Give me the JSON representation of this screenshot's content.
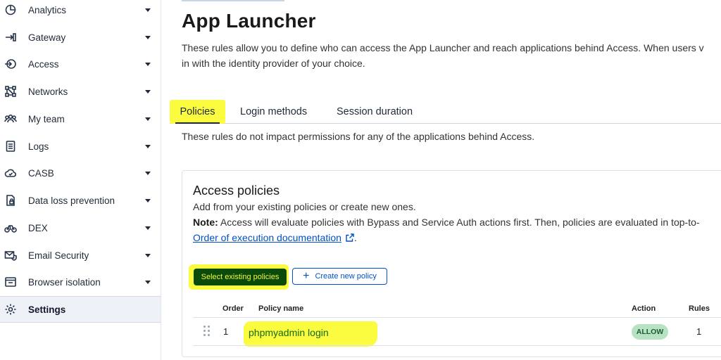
{
  "sidebar": {
    "items": [
      {
        "label": "Analytics",
        "icon": "analytics-icon"
      },
      {
        "label": "Gateway",
        "icon": "gateway-icon"
      },
      {
        "label": "Access",
        "icon": "access-icon"
      },
      {
        "label": "Networks",
        "icon": "networks-icon"
      },
      {
        "label": "My team",
        "icon": "team-icon"
      },
      {
        "label": "Logs",
        "icon": "logs-icon"
      },
      {
        "label": "CASB",
        "icon": "casb-icon"
      },
      {
        "label": "Data loss prevention",
        "icon": "dlp-icon"
      },
      {
        "label": "DEX",
        "icon": "dex-icon"
      },
      {
        "label": "Email Security",
        "icon": "email-security-icon"
      },
      {
        "label": "Browser isolation",
        "icon": "browser-isolation-icon"
      },
      {
        "label": "Settings",
        "icon": "gear-icon",
        "active": true
      }
    ]
  },
  "page": {
    "title": "App Launcher",
    "description_line1": "These rules allow you to define who can access the App Launcher and reach applications behind Access. When users v",
    "description_line2": "in with the identity provider of your choice."
  },
  "tabs": [
    {
      "label": "Policies",
      "active": true
    },
    {
      "label": "Login methods"
    },
    {
      "label": "Session duration"
    }
  ],
  "tab_description": "These rules do not impact permissions for any of the applications behind Access.",
  "policies_card": {
    "title": "Access policies",
    "subtitle": "Add from your existing policies or create new ones.",
    "note_label": "Note:",
    "note_text": " Access will evaluate policies with Bypass and Service Auth actions first. Then, policies are evaluated in top-to-",
    "link_text": "Order of execution documentation",
    "link_suffix": ".",
    "select_button": "Select existing policies",
    "create_button": "Create new policy",
    "columns": {
      "order": "Order",
      "name": "Policy name",
      "action": "Action",
      "rules": "Rules"
    },
    "rows": [
      {
        "order": "1",
        "name": "phpmyadmin login",
        "action": "ALLOW",
        "rules": "1"
      }
    ]
  },
  "colors": {
    "highlight": "#fbfb3f",
    "link": "#0051c3",
    "primary_button": "#0a4a0a",
    "allow_badge": "#b7e3c4"
  }
}
